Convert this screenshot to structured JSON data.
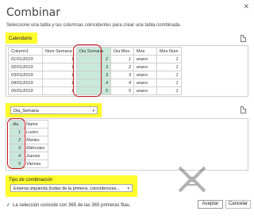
{
  "dialog": {
    "close_glyph": "✕",
    "title": "Combinar",
    "subtitle": "Seleccione una tabla y las columnas coincidentes para crear una tabla combinada."
  },
  "table1": {
    "label": "Calendario",
    "columns": [
      "Column1",
      "Num Semana",
      "Dia Semana",
      "Dia Mes",
      "Mes",
      "Mes Num"
    ],
    "rows": [
      [
        "01/01/2019",
        "1",
        "2",
        "1",
        "enero",
        "1"
      ],
      [
        "02/01/2019",
        "1",
        "3",
        "2",
        "enero",
        "1"
      ],
      [
        "03/01/2019",
        "1",
        "3",
        "3",
        "enero",
        "1"
      ],
      [
        "04/01/2019",
        "1",
        "4",
        "4",
        "enero",
        "1"
      ],
      [
        "05/01/2019",
        "1",
        "5",
        "5",
        "enero",
        "1"
      ]
    ]
  },
  "table2": {
    "select_value": "Dia_Semana",
    "columns": [
      "dia",
      "Name"
    ],
    "rows": [
      [
        "1",
        "Lunes"
      ],
      [
        "2",
        "Martes"
      ],
      [
        "3",
        "Miércoles"
      ],
      [
        "4",
        "Jueves"
      ],
      [
        "5",
        "Viernes"
      ]
    ]
  },
  "join": {
    "label": "Tipo de combinación",
    "value": "Externa izquierda (todas de la primera, coincidencias..."
  },
  "status": {
    "check_glyph": "✓",
    "text": "La selección coincide con 365 de las 365 primeras filas."
  },
  "buttons": {
    "accept": "Aceptar",
    "cancel": "Cancelar"
  },
  "colors": {
    "highlight": "#fffc2c",
    "selected_column": "#c9e8dc",
    "annotation_red": "#c3151b"
  }
}
